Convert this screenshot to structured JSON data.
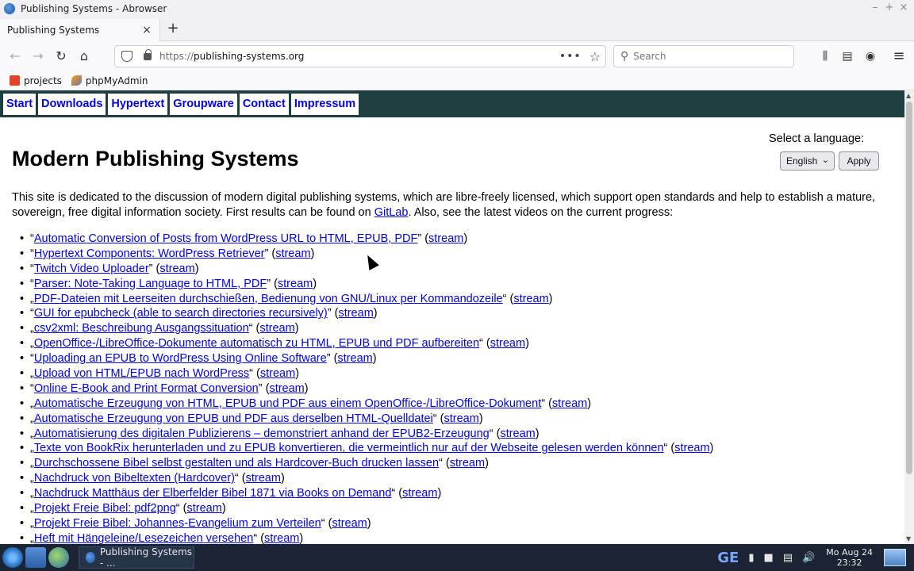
{
  "window": {
    "title": "Publishing Systems - Abrowser",
    "controls": [
      "–",
      "+",
      "×"
    ]
  },
  "tabs": [
    {
      "title": "Publishing Systems",
      "close": "×"
    }
  ],
  "new_tab": "+",
  "nav": {
    "back": "←",
    "forward": "→",
    "reload": "↻",
    "home": "⌂",
    "url_proto": "https://",
    "url_host": "publishing-systems.org",
    "page_actions": "•••",
    "bookmark_star": "☆",
    "search_placeholder": "Search",
    "library": "⫼",
    "sidebar": "▤",
    "account": "◉",
    "menu": "≡"
  },
  "bookmarks": [
    {
      "label": "projects",
      "icon": "gitlab-icon"
    },
    {
      "label": "phpMyAdmin",
      "icon": "phpmyadmin-icon"
    }
  ],
  "site_nav": [
    "Start",
    "Downloads",
    "Hypertext",
    "Groupware",
    "Contact",
    "Impressum"
  ],
  "language": {
    "label": "Select a language:",
    "selected": "English",
    "apply": "Apply"
  },
  "page_title": "Modern Publishing Systems",
  "intro": {
    "text_before": "This site is dedicated to the discussion of modern digital publishing systems, which are libre-freely licensed, which support open standards and help to establish a mature, sovereign, free digital information society. First results can be found on ",
    "link": "GitLab",
    "text_after": ". Also, see the latest videos on the current progress:"
  },
  "videos": [
    {
      "open": "“",
      "title": "Automatic Conversion of Posts from WordPress URL to HTML, EPUB, PDF",
      "close": "”"
    },
    {
      "open": "“",
      "title": "Hypertext Components: WordPress Retriever",
      "close": "”"
    },
    {
      "open": "“",
      "title": "Twitch Video Uploader",
      "close": "”"
    },
    {
      "open": "“",
      "title": "Parser: Note-Taking Language to HTML, PDF",
      "close": "”"
    },
    {
      "open": "„",
      "title": "PDF-Dateien mit Leerseiten durchschießen, Bedienung von GNU/Linux per Kommandozeile",
      "close": "“"
    },
    {
      "open": "“",
      "title": "GUI for epubcheck (able to search directories recursively)",
      "close": "”"
    },
    {
      "open": "„",
      "title": "csv2xml: Beschreibung Ausgangssituation",
      "close": "“"
    },
    {
      "open": "„",
      "title": "OpenOffice-/LibreOffice-Dokumente automatisch zu HTML, EPUB und PDF aufbereiten",
      "close": "“"
    },
    {
      "open": "“",
      "title": "Uploading an EPUB to WordPress Using Online Software",
      "close": "”"
    },
    {
      "open": "„",
      "title": "Upload von HTML/EPUB nach WordPress",
      "close": "“"
    },
    {
      "open": "“",
      "title": "Online E-Book and Print Format Conversion",
      "close": "”"
    },
    {
      "open": "„",
      "title": "Automatische Erzeugung von HTML, EPUB und PDF aus einem OpenOffice-/LibreOffice-Dokument",
      "close": "“"
    },
    {
      "open": "„",
      "title": "Automatische Erzeugung von EPUB und PDF aus derselben HTML-Quelldatei",
      "close": "“"
    },
    {
      "open": "„",
      "title": "Automatisierung des digitalen Publizierens – demonstriert anhand der EPUB2-Erzeugung",
      "close": "“"
    },
    {
      "open": "„",
      "title": "Texte von BookRix herunterladen und zu EPUB konvertieren, die vermeintlich nur auf der Webseite gelesen werden können",
      "close": "“"
    },
    {
      "open": "„",
      "title": "Durchschossene Bibel selbst gestalten und als Hardcover-Buch drucken lassen",
      "close": "“"
    },
    {
      "open": "„",
      "title": "Nachdruck von Bibeltexten (Hardcover)",
      "close": "“"
    },
    {
      "open": "„",
      "title": "Nachdruck Matthäus der Elberfelder Bibel 1871 via Books on Demand",
      "close": "“"
    },
    {
      "open": "„",
      "title": "Projekt Freie Bibel: pdf2png",
      "close": "“"
    },
    {
      "open": "„",
      "title": "Projekt Freie Bibel: Johannes-Evangelium zum Verteilen",
      "close": "“"
    },
    {
      "open": "„",
      "title": "Heft mit Hängeleine/Lesezeichen versehen",
      "close": "“"
    }
  ],
  "stream_label": "stream",
  "taskbar": {
    "task_title": "Publishing Systems - ...",
    "tray_ge": "GE",
    "clock_date": "Mo Aug 24",
    "clock_time": "23:32"
  },
  "colors": {
    "site_nav_bg": "#1e4040",
    "link": "#0000ee",
    "taskbar_bg": "#1a2433"
  }
}
